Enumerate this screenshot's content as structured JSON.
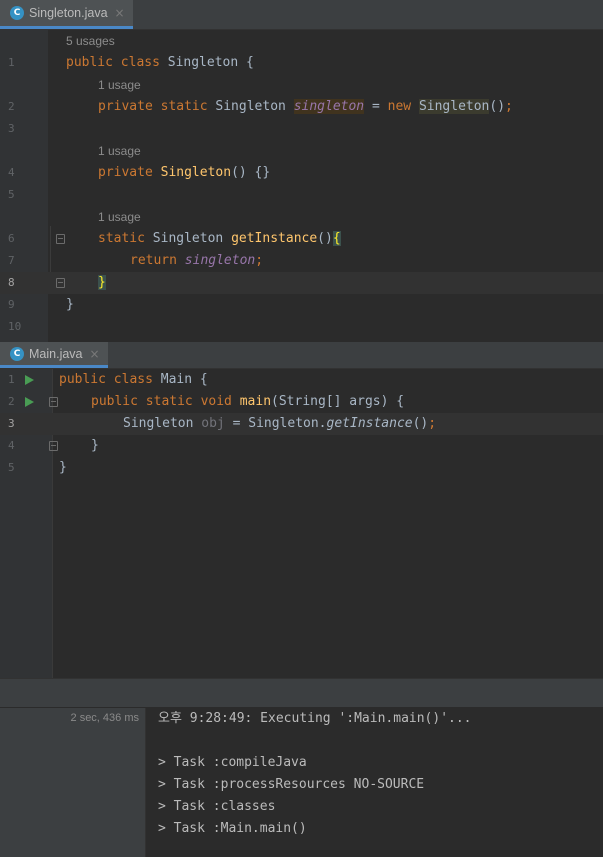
{
  "singleton_tab": {
    "label": "Singleton.java",
    "icon_letter": "C",
    "close": "×"
  },
  "main_tab": {
    "label": "Main.java",
    "icon_letter": "C",
    "close": "×"
  },
  "singleton_editor": {
    "hint_class_usages": "5 usages",
    "hint_field_usage": "1 usage",
    "hint_ctor_usage": "1 usage",
    "hint_method_usage": "1 usage",
    "line_numbers": [
      "1",
      "2",
      "3",
      "4",
      "5",
      "6",
      "7",
      "8",
      "9",
      "10"
    ],
    "l1": {
      "kw": "public class ",
      "name": "Singleton",
      "rest": " {"
    },
    "l2": {
      "kw1": "private static ",
      "type": "Singleton ",
      "field": "singleton",
      "eq": " = ",
      "kw2": "new ",
      "ctor": "Singleton",
      "tail": "()",
      "semi": ";"
    },
    "l4": {
      "kw": "private ",
      "name": "Singleton",
      "rest": "() {}"
    },
    "l6": {
      "kw": "static ",
      "type": "Singleton ",
      "name": "getInstance",
      "paren": "()",
      "brace": "{"
    },
    "l7": {
      "kw": "return ",
      "field": "singleton",
      "semi": ";"
    },
    "l8": {
      "brace": "}"
    },
    "l9": {
      "brace": "}"
    }
  },
  "main_editor": {
    "line_numbers": [
      "1",
      "2",
      "3",
      "4",
      "5"
    ],
    "l1": {
      "kw": "public class ",
      "name": "Main",
      "rest": " {"
    },
    "l2": {
      "kw": "public static void ",
      "name": "main",
      "rest": "(String[] args) {"
    },
    "l3": {
      "type": "Singleton ",
      "var": "obj",
      "eq": " = Singleton.",
      "method": "getInstance",
      "tail": "()",
      "semi": ";"
    },
    "l4": {
      "brace": "}"
    },
    "l5": {
      "brace": "}"
    }
  },
  "console": {
    "duration": "2 sec, 436 ms",
    "lines": [
      "오후 9:28:49: Executing ':Main.main()'...",
      "",
      "> Task :compileJava",
      "> Task :processResources NO-SOURCE",
      "> Task :classes",
      "> Task :Main.main()"
    ]
  },
  "colors": {
    "keyword": "#cc7832",
    "method": "#ffc66d",
    "field": "#9876aa",
    "text": "#a9b7c6",
    "run_gutter": "#499c54",
    "tab_underline": "#4a88c7",
    "file_icon": "#3592c4"
  }
}
